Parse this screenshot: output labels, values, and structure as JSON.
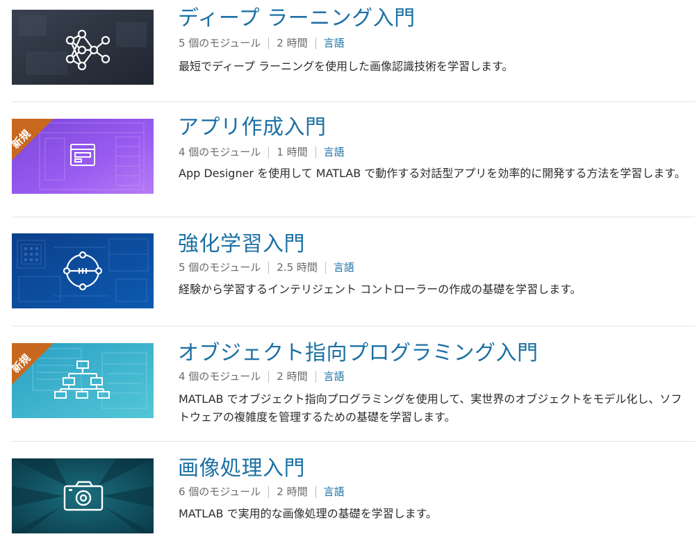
{
  "courses": [
    {
      "title": "ディープ ラーニング入門",
      "modules": "5 個のモジュール",
      "duration": "2 時間",
      "language": "言語",
      "description": "最短でディープ ラーニングを使用した画像認識技術を学習します。",
      "badge": "",
      "icon": "neural-network-icon"
    },
    {
      "title": "アプリ作成入門",
      "modules": "4 個のモジュール",
      "duration": "1 時間",
      "language": "言語",
      "description": "App Designer を使用して MATLAB で動作する対話型アプリを効率的に開発する方法を学習します。",
      "badge": "新規",
      "icon": "app-window-icon"
    },
    {
      "title": "強化学習入門",
      "modules": "5 個のモジュール",
      "duration": "2.5 時間",
      "language": "言語",
      "description": "経験から学習するインテリジェント コントローラーの作成の基礎を学習します。",
      "badge": "",
      "icon": "reinforcement-loop-icon"
    },
    {
      "title": "オブジェクト指向プログラミング入門",
      "modules": "4 個のモジュール",
      "duration": "2 時間",
      "language": "言語",
      "description": "MATLAB でオブジェクト指向プログラミングを使用して、実世界のオブジェクトをモデル化し、ソフトウェアの複雑度を管理するための基礎を学習します。",
      "badge": "新規",
      "icon": "hierarchy-icon"
    },
    {
      "title": "画像処理入門",
      "modules": "6 個のモジュール",
      "duration": "2 時間",
      "language": "言語",
      "description": "MATLAB で実用的な画像処理の基礎を学習します。",
      "badge": "",
      "icon": "camera-icon"
    }
  ],
  "colors": {
    "title": "#1c70a4",
    "badge_ribbon": "#c8681f",
    "thumb_deep_learning": "#2b3340",
    "thumb_app": "#8d52e0",
    "thumb_rl": "#0d4a9a",
    "thumb_oop": "#3fb3cc",
    "thumb_image": "#0f4d5c"
  }
}
